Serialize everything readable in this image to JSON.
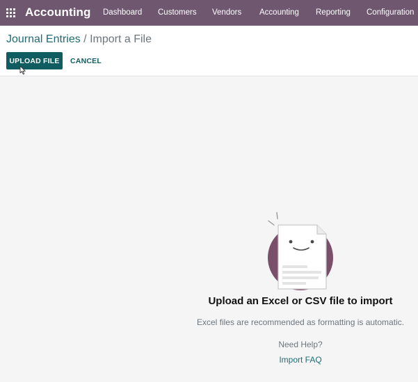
{
  "topbar": {
    "app_title": "Accounting",
    "menu": [
      "Dashboard",
      "Customers",
      "Vendors",
      "Accounting",
      "Reporting",
      "Configuration"
    ]
  },
  "breadcrumb": {
    "parent": "Journal Entries",
    "separator": " / ",
    "current": "Import a File"
  },
  "actions": {
    "upload_label": "UPLOAD FILE",
    "cancel_label": "CANCEL"
  },
  "empty_state": {
    "headline": "Upload an Excel or CSV file to import",
    "subline": "Excel files are recommended as formatting is automatic.",
    "help_text": "Need Help?",
    "faq_link": "Import FAQ"
  },
  "colors": {
    "topbar": "#6f5770",
    "primary_button": "#0f5c61",
    "link": "#1f6b73",
    "illustration_circle": "#7a4f6a"
  },
  "icons": [
    "apps-grid-icon",
    "mouse-cursor-icon",
    "smiling-document-icon"
  ]
}
